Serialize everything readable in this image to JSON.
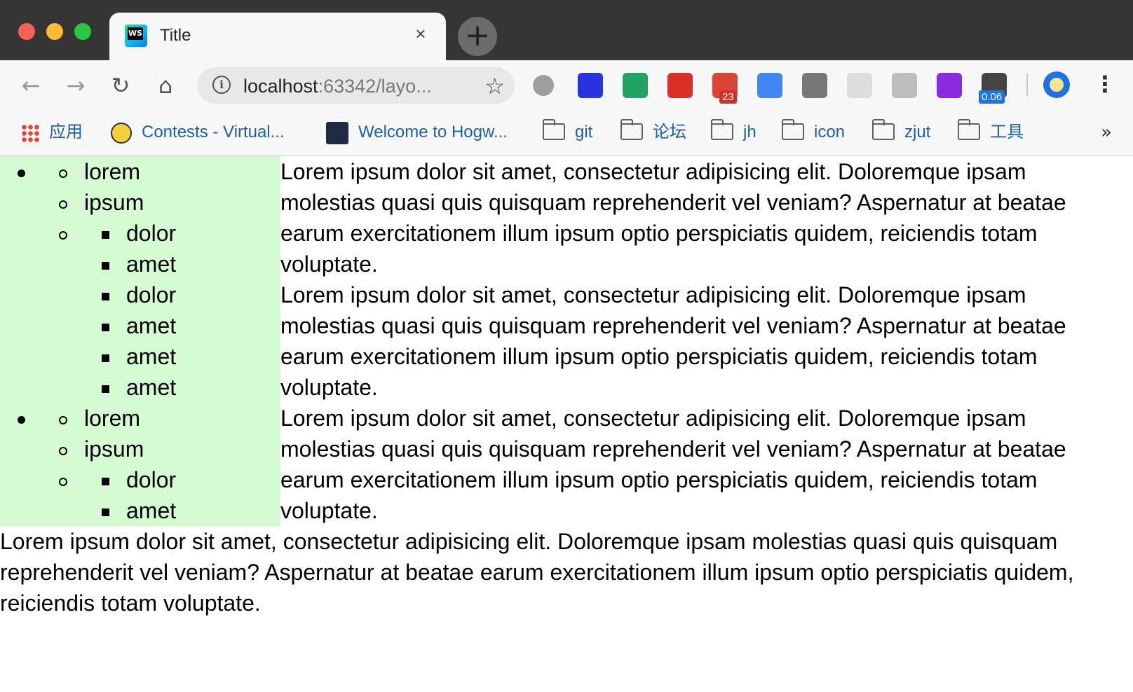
{
  "window": {
    "tab": {
      "title": "Title",
      "favicon_text": "WS",
      "close_icon": "×"
    },
    "new_tab_icon": "+"
  },
  "toolbar": {
    "back_icon": "←",
    "forward_icon": "→",
    "reload_icon": "↻",
    "home_icon": "⌂",
    "address": {
      "host": "localhost",
      "rest": ":63342/layo..."
    },
    "star_icon": "☆",
    "extensions": [
      {
        "name": "gray-circle-extension-icon",
        "color": "#9e9e9e"
      },
      {
        "name": "paw-extension-icon",
        "color": "#2932e1"
      },
      {
        "name": "shield-extension-icon",
        "color": "#1fa463"
      },
      {
        "name": "red-s-extension-icon",
        "color": "#d93025"
      },
      {
        "name": "mail-extension-icon",
        "color": "#db4437",
        "badge": "23"
      },
      {
        "name": "translate-extension-icon",
        "color": "#4285f4"
      },
      {
        "name": "screenshot-extension-icon",
        "color": "#777777"
      },
      {
        "name": "react-extension-icon",
        "color": "#dddddd"
      },
      {
        "name": "target-extension-icon",
        "color": "#bdbdbd"
      },
      {
        "name": "rp-extension-icon",
        "color": "#8a2be2"
      },
      {
        "name": "user-extension-icon",
        "color": "#444444",
        "badge": "0.06"
      }
    ],
    "menu_icon": "⋮"
  },
  "bookmarks": [
    {
      "label": "应用",
      "icon": "apps-grid-icon"
    },
    {
      "label": "Contests - Virtual...",
      "icon": "smiley-icon"
    },
    {
      "label": "Welcome to Hogw...",
      "icon": "feather-icon"
    },
    {
      "label": "git",
      "icon": "folder-icon"
    },
    {
      "label": "论坛",
      "icon": "folder-icon"
    },
    {
      "label": "jh",
      "icon": "folder-icon"
    },
    {
      "label": "icon",
      "icon": "folder-icon"
    },
    {
      "label": "zjut",
      "icon": "folder-icon"
    },
    {
      "label": "工具",
      "icon": "folder-icon"
    }
  ],
  "bookmarks_overflow": "»",
  "content": {
    "list_rows": [
      {
        "disc": true,
        "circle": true,
        "square": false,
        "text": "lorem",
        "level": 2
      },
      {
        "disc": false,
        "circle": true,
        "square": false,
        "text": "ipsum",
        "level": 2
      },
      {
        "disc": false,
        "circle": true,
        "square": true,
        "text": "dolor",
        "level": 3
      },
      {
        "disc": false,
        "circle": false,
        "square": true,
        "text": "amet",
        "level": 3
      },
      {
        "disc": false,
        "circle": false,
        "square": true,
        "text": "dolor",
        "level": 3
      },
      {
        "disc": false,
        "circle": false,
        "square": true,
        "text": "amet",
        "level": 3
      },
      {
        "disc": false,
        "circle": false,
        "square": true,
        "text": "amet",
        "level": 3
      },
      {
        "disc": false,
        "circle": false,
        "square": true,
        "text": "amet",
        "level": 3
      },
      {
        "disc": true,
        "circle": true,
        "square": false,
        "text": "lorem",
        "level": 2
      },
      {
        "disc": false,
        "circle": true,
        "square": false,
        "text": "ipsum",
        "level": 2
      },
      {
        "disc": false,
        "circle": true,
        "square": true,
        "text": "dolor",
        "level": 3
      },
      {
        "disc": false,
        "circle": false,
        "square": true,
        "text": "amet",
        "level": 3
      }
    ],
    "paragraph_lines": [
      "Lorem ipsum dolor sit amet, consectetur adipisicing elit. Doloremque ipsam",
      "molestias quasi quis quisquam reprehenderit vel veniam? Aspernatur at beatae",
      "earum exercitationem illum ipsum optio perspiciatis quidem, reiciendis totam",
      "voluptate.",
      "Lorem ipsum dolor sit amet, consectetur adipisicing elit. Doloremque ipsam",
      "molestias quasi quis quisquam reprehenderit vel veniam? Aspernatur at beatae",
      "earum exercitationem illum ipsum optio perspiciatis quidem, reiciendis totam",
      "voluptate.",
      "Lorem ipsum dolor sit amet, consectetur adipisicing elit. Doloremque ipsam",
      "molestias quasi quis quisquam reprehenderit vel veniam? Aspernatur at beatae",
      "earum exercitationem illum ipsum optio perspiciatis quidem, reiciendis totam",
      "voluptate."
    ],
    "bottom_paragraph_lines": [
      "Lorem ipsum dolor sit amet, consectetur adipisicing elit. Doloremque ipsam molestias quasi quis quisquam",
      "reprehenderit vel veniam? Aspernatur at beatae earum exercitationem illum ipsum optio perspiciatis quidem,",
      "reiciendis totam voluptate."
    ],
    "sidebar_bg": "#d4fbd2"
  }
}
